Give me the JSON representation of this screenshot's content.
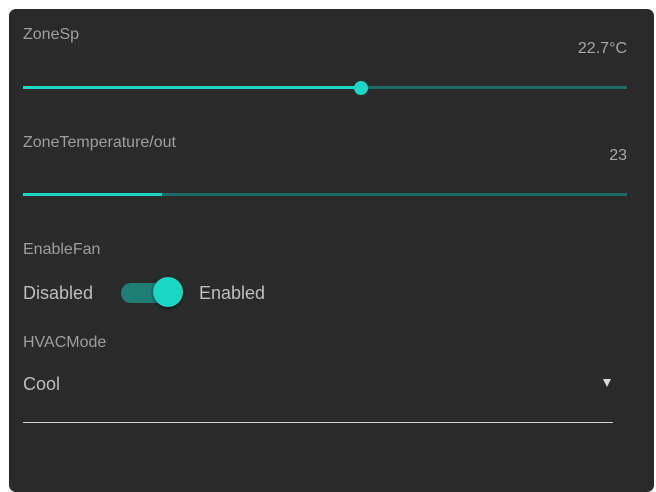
{
  "zone_sp": {
    "label": "ZoneSp",
    "value_text": "22.7°C",
    "slider_fraction": 0.56
  },
  "zone_temperature": {
    "label": "ZoneTemperature/out",
    "value_text": "23",
    "progress_fraction": 0.23
  },
  "enable_fan": {
    "label": "EnableFan",
    "off_label": "Disabled",
    "on_label": "Enabled",
    "state": "on"
  },
  "hvac_mode": {
    "label": "HVACMode",
    "selected": "Cool"
  },
  "colors": {
    "panel_background": "#2a2a2a",
    "accent": "#1cd6c4",
    "track_inactive": "#1e6b66",
    "switch_track_on": "#1f7e73"
  }
}
